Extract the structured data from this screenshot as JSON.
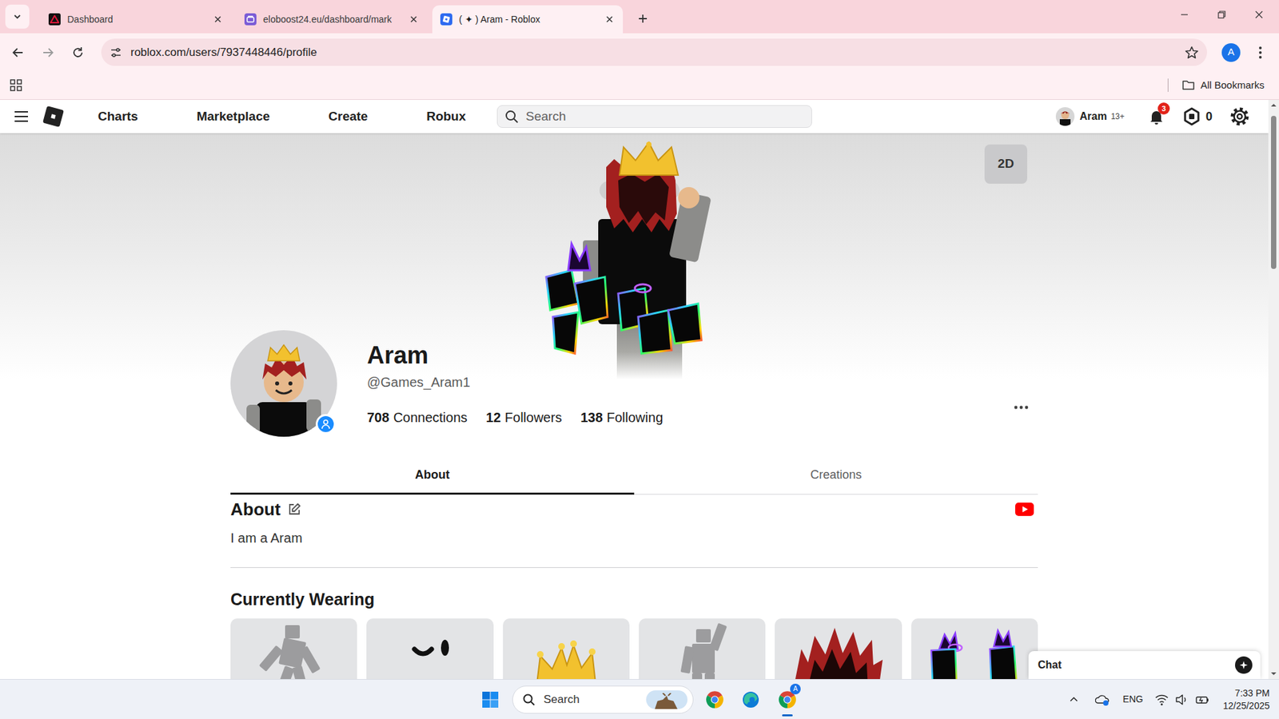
{
  "browser": {
    "tabs": [
      {
        "label": "Dashboard",
        "kind": "triangle",
        "selected": false
      },
      {
        "label": "eloboost24.eu/dashboard/mark",
        "kind": "store",
        "selected": false
      },
      {
        "label": "( ✦ ) Aram - Roblox",
        "kind": "roblox",
        "selected": true
      }
    ],
    "url": "roblox.com/users/7937448446/profile",
    "profile_initial": "A",
    "bookmarks_label": "All Bookmarks"
  },
  "header": {
    "nav": [
      "Charts",
      "Marketplace",
      "Create",
      "Robux"
    ],
    "search_placeholder": "Search",
    "user_name": "Aram",
    "age_label": "13+",
    "notifications": "3",
    "robux": "0"
  },
  "profile": {
    "view_toggle": "2D",
    "display_name": "Aram",
    "username": "@Games_Aram1",
    "stats": [
      {
        "value": "708",
        "label": "Connections"
      },
      {
        "value": "12",
        "label": "Followers"
      },
      {
        "value": "138",
        "label": "Following"
      }
    ]
  },
  "profile_tabs": [
    {
      "label": "About",
      "selected": true
    },
    {
      "label": "Creations",
      "selected": false
    }
  ],
  "about": {
    "heading": "About",
    "text": "I am a Aram"
  },
  "currently_wearing": {
    "heading": "Currently Wearing",
    "items": [
      {
        "kind": "animation"
      },
      {
        "kind": "face"
      },
      {
        "kind": "crown"
      },
      {
        "kind": "emote"
      },
      {
        "kind": "hair"
      },
      {
        "kind": "wings"
      }
    ]
  },
  "chat": {
    "label": "Chat"
  },
  "taskbar": {
    "search_label": "Search",
    "chrome_profile_badge": "A",
    "language": "ENG",
    "time": "7:33 PM",
    "date": "12/25/2025"
  }
}
